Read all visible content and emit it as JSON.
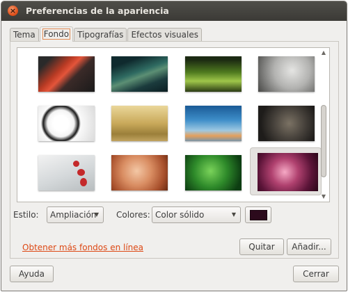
{
  "window": {
    "title": "Preferencias de la apariencia"
  },
  "tabs": [
    {
      "label": "Tema",
      "active": false
    },
    {
      "label": "Fondo",
      "active": true
    },
    {
      "label": "Tipografías",
      "active": false
    },
    {
      "label": "Efectos visuales",
      "active": false
    }
  ],
  "wallpapers": [
    {
      "name": "red-ribbon"
    },
    {
      "name": "green-leaf-macro"
    },
    {
      "name": "green-grass"
    },
    {
      "name": "water-drops"
    },
    {
      "name": "dalmatian"
    },
    {
      "name": "dandelion-field"
    },
    {
      "name": "sky-clouds"
    },
    {
      "name": "rope-knot"
    },
    {
      "name": "red-leaves-mist"
    },
    {
      "name": "cinnamon-sticks"
    },
    {
      "name": "fern-curl"
    },
    {
      "name": "purple-warty",
      "selected": true
    }
  ],
  "style": {
    "label": "Estilo:",
    "value": "Ampliación"
  },
  "colors": {
    "label": "Colores:",
    "value": "Color sólido",
    "swatch": "#2c0a1c"
  },
  "link": {
    "label": "Obtener más fondos en línea"
  },
  "buttons": {
    "remove": "Quitar",
    "add": "Añadir...",
    "help": "Ayuda",
    "close": "Cerrar"
  },
  "theme": {
    "accent": "#dd4814",
    "titlebar": "#3c3b37"
  }
}
